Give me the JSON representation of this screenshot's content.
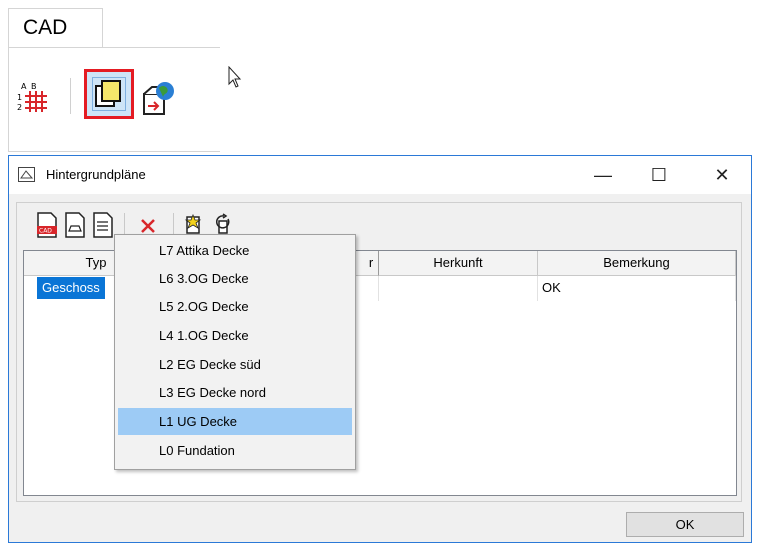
{
  "ribbon": {
    "tab_label": "CAD",
    "buttons": [
      {
        "icon": "numbered-grid-icon"
      },
      {
        "icon": "background-plan-icon",
        "highlighted": true
      },
      {
        "icon": "globe-import-icon"
      }
    ]
  },
  "dialog": {
    "title": "Hintergrundpläne",
    "controls": {
      "minimize": "—",
      "maximize": "☐",
      "close": "✕"
    },
    "toolbar": [
      "cad-file-icon",
      "document-icon",
      "document-lines-icon",
      "delete-icon",
      "edit-star-icon",
      "refresh-icon"
    ],
    "columns": [
      "Typ",
      "",
      "Herkunft",
      "Bemerkung"
    ],
    "column_tail": "r",
    "rows": [
      {
        "typ": "Geschoss",
        "other": "",
        "herkunft": "",
        "bemerkung": "OK"
      }
    ],
    "ok_label": "OK"
  },
  "menu": {
    "items": [
      {
        "label": "L7  Attika Decke",
        "selected": false
      },
      {
        "label": "L6  3.OG Decke",
        "selected": false
      },
      {
        "label": "L5  2.OG Decke",
        "selected": false
      },
      {
        "label": "L4  1.OG Decke",
        "selected": false
      },
      {
        "label": "L2  EG Decke süd",
        "selected": false
      },
      {
        "label": "L3  EG Decke nord",
        "selected": false
      },
      {
        "label": "L1  UG Decke",
        "selected": true
      },
      {
        "label": "L0  Fundation",
        "selected": false
      }
    ]
  },
  "colors": {
    "highlight_border": "#e41b23",
    "selection_blue": "#0a75d6",
    "menu_selected": "#9dcbf5",
    "dialog_border": "#2b79d7"
  }
}
